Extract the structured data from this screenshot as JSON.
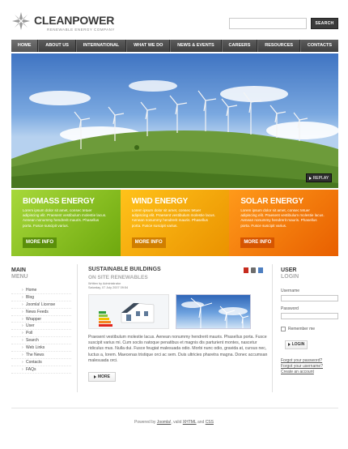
{
  "logo": {
    "title_bold": "CLEAN",
    "title_rest": "POWER",
    "tagline": "renewable energy company",
    "icon": "logo-star-icon"
  },
  "search": {
    "placeholder": "",
    "button_label": "SEARCH"
  },
  "nav": {
    "items": [
      "HOME",
      "ABOUT US",
      "INTERNATIONAL",
      "WHAT WE DO",
      "NEWS & EVENTS",
      "CAREERS",
      "RESOURCES",
      "CONTACTS"
    ]
  },
  "hero": {
    "replay_label": "REPLAY"
  },
  "panels": [
    {
      "title": "BIOMASS ENERGY",
      "text": "Lorem ipsum dolor sit amet, consec tetuer adipiscing elit. Praesent vestibulum molestie lacus. Aenean nonummy hendrerit mauris. Phasellus porta. Fusce suscipit varius.",
      "more_label": "MORE INFO",
      "color": "#8cc21f"
    },
    {
      "title": "WIND ENERGY",
      "text": "Lorem ipsum dolor sit amet, consec tetuer adipiscing elit. Praesent vestibulum molestie lacus. Aenean nonummy hendrerit mauris. Phasellus porta. Fusce suscipit varius.",
      "more_label": "MORE INFO",
      "color": "#f7a90a"
    },
    {
      "title": "SOLAR ENERGY",
      "text": "Lorem ipsum dolor sit amet, consec tetuer adipiscing elit. Praesent vestibulum molestie lacus. Aenean nonummy hendrerit mauris. Phasellus porta. Fusce suscipit varius.",
      "more_label": "MORE INFO",
      "color": "#f57f0a"
    }
  ],
  "menu": {
    "heading_line1": "MAIN",
    "heading_line2": "MENU",
    "items": [
      "Home",
      "Blog",
      "Joomla! License",
      "News Feeds",
      "Wrapper",
      "User",
      "Poll",
      "Search",
      "Web Links",
      "The News",
      "Contacts",
      "FAQs"
    ]
  },
  "article": {
    "title": "SUSTAINABLE BUILDINGS",
    "subtitle": "ON SITE RENEWABLES",
    "meta_author": "Written by Administrator",
    "meta_date": "Saturday, 07 July 2007 09:54",
    "body": "Praesent vestibulum molestie lacus. Aenean nonummy hendrerit mauris. Phasellus porta. Fusce suscipit varius mi. Cum sociis natoque penatibus et magnis dis parturient montes, nascetur ridiculus mus. Nulla dui. Fusce feugiat malesuada odio. Morbi nunc odio, gravida at, cursus nec, luctus a, lorem. Maecenas tristique orci ac sem. Duis ultricies pharetra magna. Donec accumsan malesuada orci.",
    "more_label": "MORE",
    "icons": [
      "pdf-icon",
      "print-icon",
      "email-icon"
    ]
  },
  "user": {
    "heading_line1": "USER",
    "heading_line2": "LOGIN",
    "username_label": "Username",
    "password_label": "Password",
    "remember_label": "Remember me",
    "login_label": "LOGIN",
    "links": [
      "Forgot your password?",
      "Forgot your username?",
      "Create an account"
    ]
  },
  "footer": {
    "prefix": "Powered by",
    "joomla": "Joomla!",
    "mid1": "valid",
    "xhtml": "XHTML",
    "mid2": "and",
    "css": "CSS"
  }
}
